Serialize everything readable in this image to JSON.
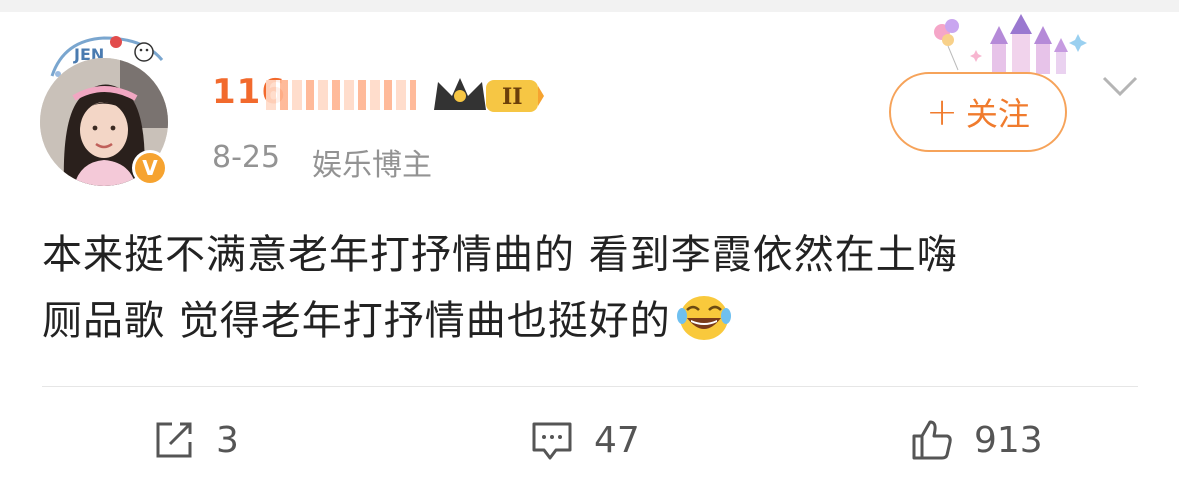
{
  "post": {
    "username": "116",
    "date": "8-25",
    "source": "娱乐博主",
    "verified_badge": "V",
    "follow_label": "关注",
    "follow_plus": "+",
    "text_line1": "本来挺不满意老年打抒情曲的 看到李霞依然在土嗨",
    "text_line2": "厕品歌 觉得老年打抒情曲也挺好的",
    "emoji": "laughing-tears-emoji",
    "crown_level": "II"
  },
  "actions": {
    "repost_count": "3",
    "comment_count": "47",
    "like_count": "913"
  },
  "colors": {
    "accent_orange": "#f07b2d",
    "username_orange": "#f26a2d",
    "meta_gray": "#939393",
    "badge_orange": "#f6a330"
  }
}
